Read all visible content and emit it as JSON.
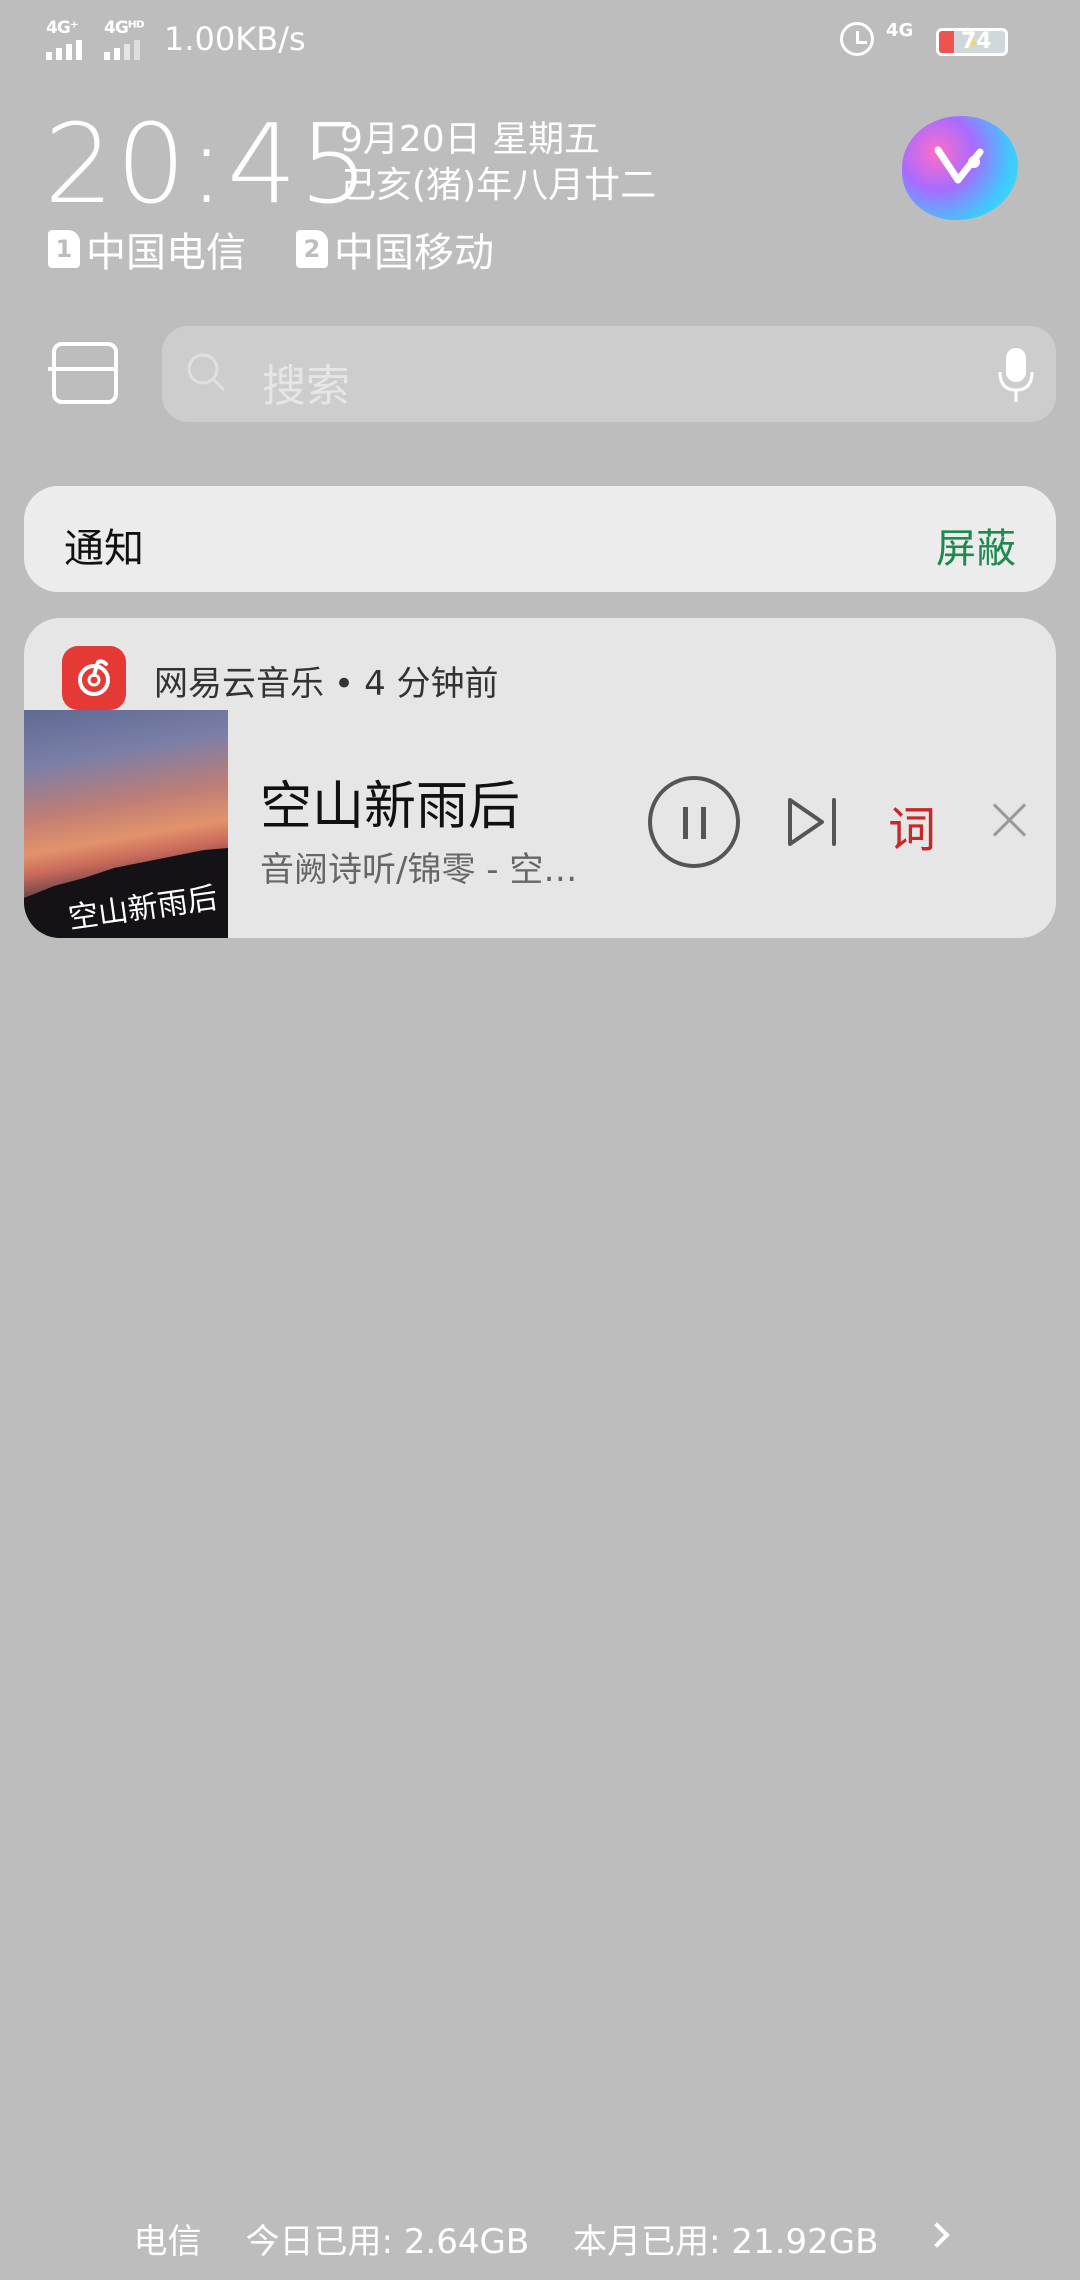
{
  "status_bar": {
    "sim1_network": "4G⁺",
    "sim2_network": "4Gᴴᴰ",
    "speed": "1.00KB/s",
    "right_network": "4G",
    "battery_level": "74"
  },
  "header": {
    "time": "20:45",
    "date_line1": "9月20日 星期五",
    "date_line2": "己亥(猪)年八月廿二",
    "carriers": [
      {
        "sim": "1",
        "name": "中国电信"
      },
      {
        "sim": "2",
        "name": "中国移动"
      }
    ]
  },
  "search": {
    "placeholder": "搜索"
  },
  "notifications": {
    "title": "通知",
    "mute_label": "屏蔽"
  },
  "music_notification": {
    "app_name": "网易云音乐",
    "separator": "•",
    "time_ago": "4 分钟前",
    "song_title": "空山新雨后",
    "song_subtitle": "音阙诗听/锦零 - 空…",
    "cover_text": "空山新雨后",
    "lyrics_label": "词"
  },
  "footer": {
    "carrier": "电信",
    "today_usage": "今日已用: 2.64GB",
    "month_usage": "本月已用: 21.92GB"
  },
  "colors": {
    "background": "#bdbdbd",
    "card": "#e6e6e6",
    "mute_green": "#1e8a4f",
    "netease_red": "#e53935",
    "lyrics_red": "#c62828"
  }
}
